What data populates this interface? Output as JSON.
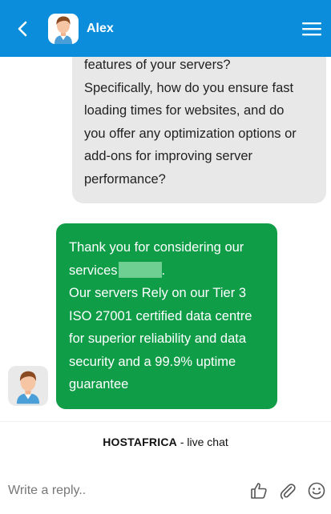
{
  "header": {
    "contact_name": "Alex",
    "background_color": "#0b8ddb",
    "back_icon": "chevron-left-icon",
    "menu_icon": "hamburger-menu-icon"
  },
  "messages": [
    {
      "sender": "user",
      "lines": [
        "features of your servers?",
        "Specifically, how do you ensure fast",
        "loading times for websites, and do",
        "you offer any optimization options or",
        "add-ons for improving server",
        "performance?"
      ],
      "bubble_color": "#e8e8e8"
    },
    {
      "sender": "agent",
      "line1": "Thank you for considering our",
      "line2": "services",
      "line2_suffix": ".",
      "line2_redacted": true,
      "lines": [
        "Our servers Rely on our Tier 3",
        "ISO 27001 certified data centre",
        "for superior reliability and data",
        "security and a 99.9% uptime",
        "guarantee"
      ],
      "bubble_color": "#0f9d48"
    }
  ],
  "branding": {
    "brand": "HOSTAFRICA",
    "suffix": " - live chat"
  },
  "composer": {
    "placeholder": "Write a reply..",
    "icons": [
      "thumbs-up-icon",
      "paperclip-icon",
      "smiley-icon"
    ]
  }
}
